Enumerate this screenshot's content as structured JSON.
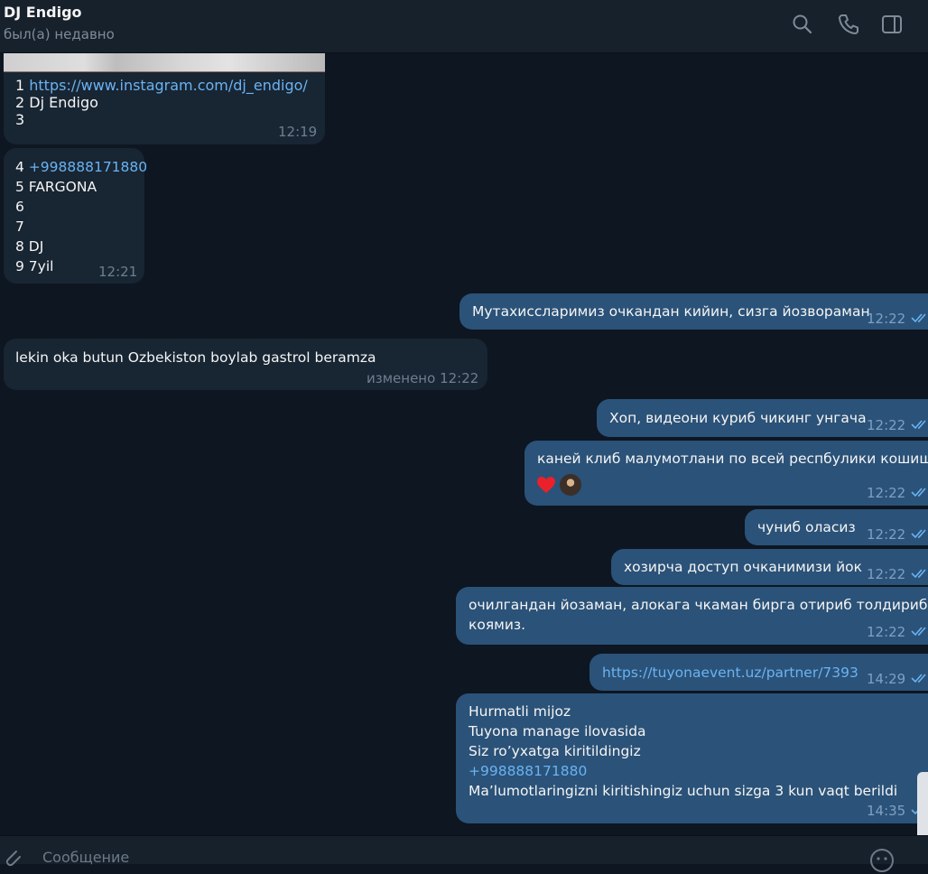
{
  "header": {
    "title": "DJ Endigo",
    "status": "был(а) недавно"
  },
  "messages": [
    {
      "dir": "in",
      "lines": [
        "1 ",
        "2 Dj Endigo",
        "3"
      ],
      "link": "https://www.instagram.com/dj_endigo/",
      "time": "12:19"
    },
    {
      "dir": "in",
      "lines": [
        "4 ",
        "5 FARGONA",
        "6",
        "7",
        "8 DJ",
        "9 7yil"
      ],
      "link": "+998888171880",
      "time": "12:21"
    },
    {
      "dir": "out",
      "text": "Мутахиссларимиз очкандан кийин, сизга йозвораман",
      "time": "12:22"
    },
    {
      "dir": "in",
      "text": "lekin oka butun Ozbekiston boylab gastrol beramza",
      "edited": "изменено",
      "time": "12:22"
    },
    {
      "dir": "out",
      "text": "Хоп, видеони куриб чикинг унгача",
      "time": "12:22"
    },
    {
      "dir": "out",
      "text": "каней клиб малумотлани по всей респбулики кошишти",
      "time": "12:22"
    },
    {
      "dir": "out",
      "text": "чуниб оласиз",
      "time": "12:22"
    },
    {
      "dir": "out",
      "text": "хозирча доступ очканимизи йок",
      "time": "12:22"
    },
    {
      "dir": "out",
      "lines": [
        "очилгандан йозаман, алокага чкаман бирга отириб толдириб",
        "коямиз."
      ],
      "time": "12:22"
    },
    {
      "dir": "out",
      "link": "https://tuyonaevent.uz/partner/7393",
      "time": "14:29"
    },
    {
      "dir": "out",
      "lines": [
        "Hurmatli mijoz",
        "Tuyona manage ilovasida",
        "Siz ro’yxatga kiritildingiz",
        "+998888171880",
        "Ma’lumotlaringizni kiritishingiz uchun sizga 3 kun vaqt berildi"
      ],
      "time": "14:35"
    }
  ],
  "composer": {
    "placeholder": "Сообщение"
  },
  "icons": {
    "search": "search-icon",
    "call": "phone-icon",
    "sidebar": "sidebar-toggle-icon",
    "attach": "paperclip-icon",
    "emoji": "emoji-icon",
    "heart": "heart-reaction-icon"
  },
  "colors": {
    "background": "#0e1621",
    "header": "#17212b",
    "incoming": "#182533",
    "outgoing": "#2b5278",
    "link": "#6ab3f3"
  }
}
